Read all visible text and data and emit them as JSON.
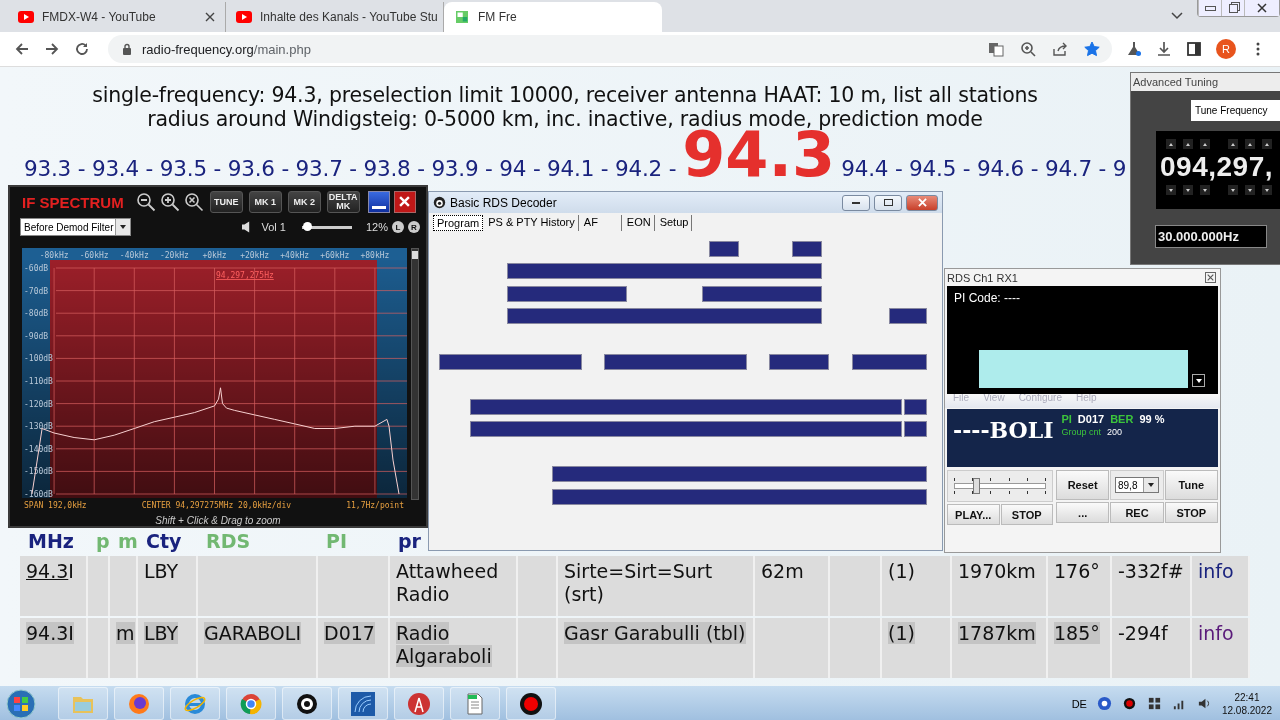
{
  "browser": {
    "tabs": [
      {
        "title": "FMDX-W4 - YouTube",
        "selected": false
      },
      {
        "title": "Inhalte des Kanals - YouTube Stu",
        "selected": false
      },
      {
        "title": "FM Fre",
        "selected": true
      }
    ],
    "url_host": "radio-frequency.org",
    "url_path": "/main.php",
    "profile": "R",
    "bookmarked": true
  },
  "page": {
    "heading": [
      "single-frequency: 94.3, preselection limit 10000, receiver antenna HAAT: 10 m, list all stations",
      "radius around Windigsteig: 0-5000 km, inc. inactive, radius mode, prediction mode"
    ],
    "freq_before": "93.3 - 93.4 - 93.5 - 93.6 - 93.7 - 93.8 - 93.9 - 94 - 94.1 - 94.2 -",
    "freq_current": "94.3",
    "freq_after": "94.4 - 94.5 - 94.6 - 94.7 - 9",
    "table": {
      "columns": [
        {
          "label": "MHz",
          "faded": false
        },
        {
          "label": "p",
          "faded": true
        },
        {
          "label": "m",
          "faded": true
        },
        {
          "label": "Cty",
          "faded": false
        },
        {
          "label": "RDS",
          "faded": true
        },
        {
          "label": "PI",
          "faded": true
        },
        {
          "label": "pr",
          "faded": false
        }
      ],
      "rows": [
        {
          "cells": [
            {
              "text": "94.3",
              "suffix": "I",
              "linked": true,
              "marked": false
            },
            {
              "text": ""
            },
            {
              "text": ""
            },
            {
              "text": "LBY",
              "marked": false
            },
            {
              "text": ""
            },
            {
              "text": ""
            },
            {
              "text": "Attawheed Radio",
              "marked": false
            },
            {
              "text": ""
            },
            {
              "text": "Sirte=Sirt=Surt (srt)",
              "marked": false
            },
            {
              "text": "62m",
              "marked": false
            },
            {
              "text": ""
            },
            {
              "text": "(1)",
              "marked": false
            },
            {
              "text": "1970km",
              "marked": false
            },
            {
              "text": "176°",
              "marked": false
            },
            {
              "text": "-332f#",
              "marked": false
            },
            {
              "text": "info",
              "marked": false,
              "visited": false
            }
          ]
        },
        {
          "cells": [
            {
              "text": "94.3I",
              "linked": false,
              "marked": true
            },
            {
              "text": ""
            },
            {
              "text": "m",
              "marked": true
            },
            {
              "text": "LBY",
              "marked": true
            },
            {
              "text": "GARABOLI",
              "marked": true
            },
            {
              "text": "D017",
              "marked": true
            },
            {
              "text": "Radio Algaraboli",
              "marked": true
            },
            {
              "text": ""
            },
            {
              "text": "Gasr Garabulli (tbl)",
              "marked": true
            },
            {
              "text": ""
            },
            {
              "text": ""
            },
            {
              "text": "(1)",
              "marked": true
            },
            {
              "text": "1787km",
              "marked": true
            },
            {
              "text": "185°",
              "marked": true
            },
            {
              "text": "-294f",
              "marked": false
            },
            {
              "text": "info",
              "marked": false,
              "visited": true
            }
          ]
        }
      ]
    }
  },
  "if_spectrum": {
    "title": "IF SPECTRUM",
    "buttons": [
      "TUNE",
      "MK 1",
      "MK 2",
      "DELTA MK"
    ],
    "filter": "Before Demod Filter",
    "volume_label": "Vol 1",
    "volume": {
      "level": 0.1
    },
    "volume_reading": "12%",
    "channels": [
      "L",
      "R"
    ],
    "marker": "94,297,275Hz",
    "span": "SPAN 192,0kHz",
    "center": "CENTER 94,297275MHz 20,0kHz/div",
    "resolution": "11,7Hz/point",
    "hint": "Shift + Click & Drag to zoom",
    "chart_data": {
      "type": "line",
      "x": [
        -91,
        -86,
        -80,
        -70,
        -60,
        -50,
        -40,
        -30,
        -20,
        -10,
        0,
        2,
        3,
        4,
        6,
        10,
        20,
        30,
        40,
        50,
        60,
        70,
        80,
        86,
        87,
        89,
        92
      ],
      "grid": true,
      "series": [
        {
          "color": "#f7d0d0",
          "values": [
            -160,
            -131,
            -133,
            -135,
            -136,
            -134,
            -131,
            -128,
            -126,
            -124,
            -121,
            -118,
            -113,
            -120,
            -122,
            -123,
            -125,
            -127,
            -129,
            -131,
            -131,
            -130,
            -130,
            -127,
            -130,
            -145,
            -160
          ]
        }
      ],
      "xlim": [
        -96,
        96
      ],
      "ylim": [
        -160,
        -60
      ],
      "xticks": [
        {
          "value": -80,
          "label": "-80kHz"
        },
        {
          "value": -60,
          "label": "-60kHz"
        },
        {
          "value": -40,
          "label": "-40kHz"
        },
        {
          "value": -20,
          "label": "-20kHz"
        },
        {
          "value": 0,
          "label": "+0kHz"
        },
        {
          "value": 20,
          "label": "+20kHz"
        },
        {
          "value": 40,
          "label": "+40kHz"
        },
        {
          "value": 60,
          "label": "+60kHz"
        },
        {
          "value": 80,
          "label": "+80kHz"
        }
      ],
      "yticks": [
        {
          "value": -60,
          "label": "-60dB"
        },
        {
          "value": -70,
          "label": "-70dB"
        },
        {
          "value": -80,
          "label": "-80dB"
        },
        {
          "value": -90,
          "label": "-90dB"
        },
        {
          "value": -100,
          "label": "-100dB"
        },
        {
          "value": -110,
          "label": "-110dB"
        },
        {
          "value": -120,
          "label": "-120dB"
        },
        {
          "value": -130,
          "label": "-130dB"
        },
        {
          "value": -140,
          "label": "-140dB"
        },
        {
          "value": -150,
          "label": "-150dB"
        },
        {
          "value": -160,
          "label": "-160dB"
        }
      ]
    }
  },
  "rds_decoder": {
    "title": "Basic RDS Decoder",
    "tabs": [
      {
        "label": "Program",
        "selected": true
      },
      {
        "label": "PS & PTY History",
        "selected": false
      },
      {
        "label": "AF",
        "selected": false
      },
      {
        "label": "EON",
        "selected": false
      },
      {
        "label": "Setup",
        "selected": false
      }
    ]
  },
  "advanced_tuning": {
    "title": "Advanced Tuning",
    "button": "Tune Frequency",
    "digits": "094,297,",
    "step": "30.000.000Hz"
  },
  "rds_channel": {
    "title": "RDS Ch1 RX1",
    "pi_code": "PI Code: ----",
    "menu": [
      "File",
      "View",
      "Configure",
      "Help"
    ],
    "ps": "----BOLI",
    "pi_label": "PI",
    "pi": "D017",
    "ber_label": "BER",
    "ber": "99 %",
    "group_label": "Group cnt",
    "group": "200",
    "slider": {
      "level": 0.23
    },
    "left_buttons": [
      "PLAY...",
      "STOP"
    ],
    "top_controls": [
      {
        "kind": "button",
        "label": "Reset"
      },
      {
        "kind": "dropdown",
        "label": "89,8"
      },
      {
        "kind": "button",
        "label": "Tune"
      }
    ],
    "bottom_buttons": [
      "...",
      "REC",
      "STOP"
    ]
  },
  "taskbar": {
    "apps": [
      {
        "kind": "folder"
      },
      {
        "kind": "firefox"
      },
      {
        "kind": "ie"
      },
      {
        "kind": "chrome"
      },
      {
        "kind": "disc"
      },
      {
        "kind": "waves"
      },
      {
        "kind": "tower"
      },
      {
        "kind": "document"
      },
      {
        "kind": "record"
      }
    ],
    "language": "DE",
    "time": "22:41",
    "date": "12.08.2022"
  }
}
